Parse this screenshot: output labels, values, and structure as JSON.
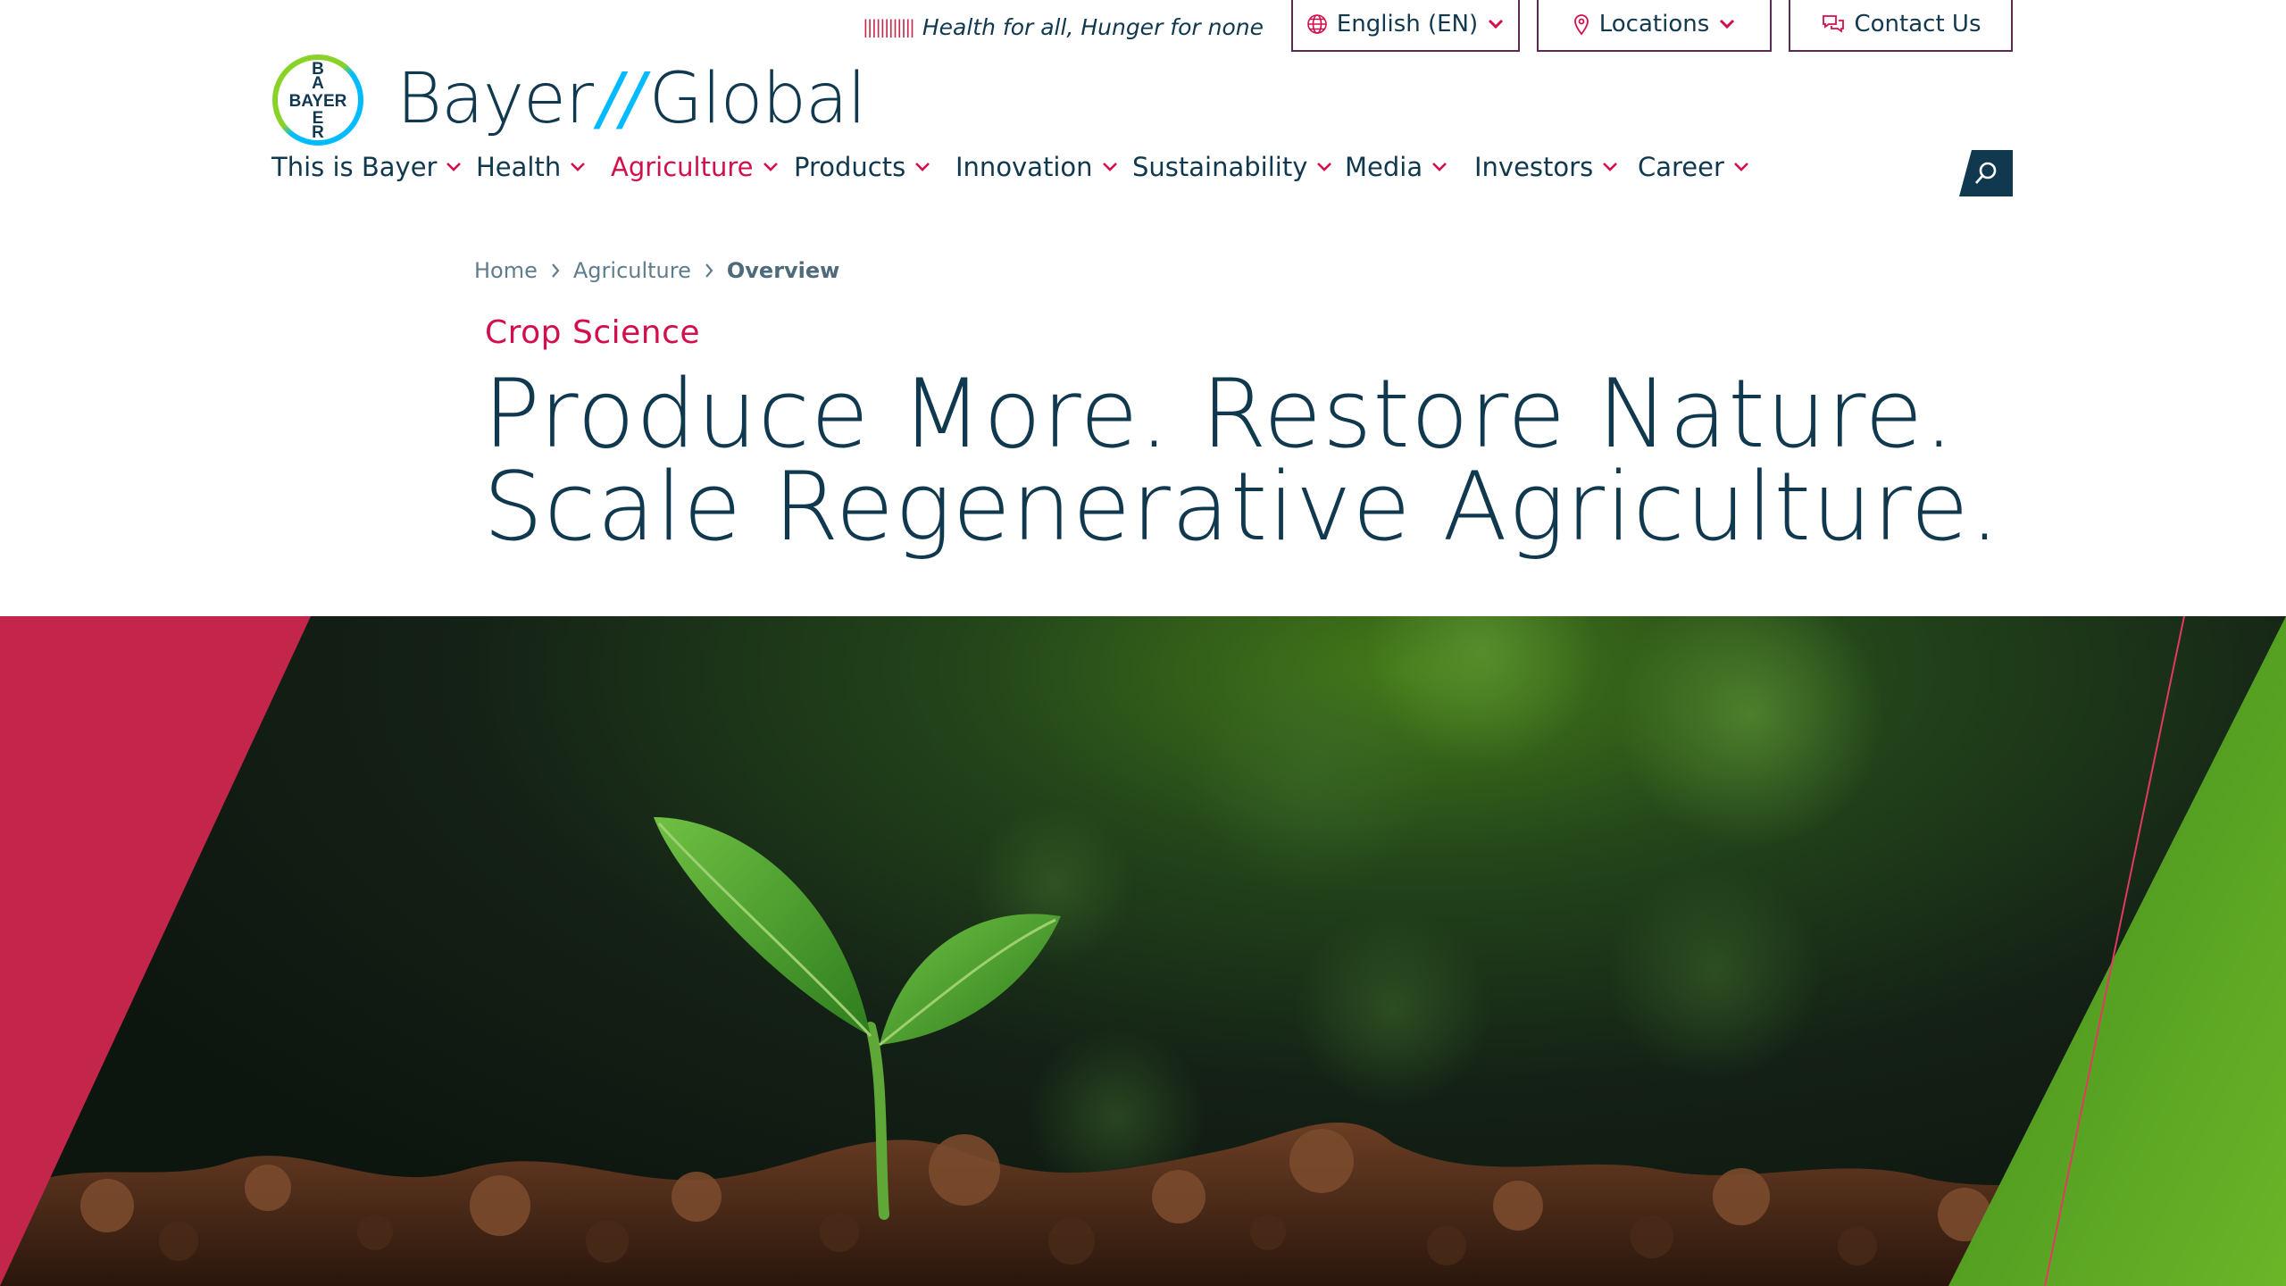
{
  "utility": {
    "tagline_mark": "||||||||||||",
    "tagline": "Health for all, Hunger for none",
    "language_label": "English (EN)",
    "locations_label": "Locations",
    "contact_label": "Contact Us"
  },
  "brand": {
    "logo_letters": "BAYER",
    "name": "Bayer",
    "separator": "//",
    "site": "Global"
  },
  "nav": {
    "items": [
      {
        "label": "This is Bayer"
      },
      {
        "label": "Health"
      },
      {
        "label": "Agriculture",
        "active": true
      },
      {
        "label": "Products"
      },
      {
        "label": "Innovation"
      },
      {
        "label": "Sustainability"
      },
      {
        "label": "Media"
      },
      {
        "label": "Investors"
      },
      {
        "label": "Career"
      }
    ]
  },
  "breadcrumb": [
    "Home",
    "Agriculture",
    "Overview"
  ],
  "hero": {
    "eyebrow": "Crop Science",
    "headline_line1": "Produce More. Restore Nature.",
    "headline_line2": "Scale Regenerative Agriculture."
  },
  "colors": {
    "navy": "#10384f",
    "accent_magenta": "#d30f4b",
    "brand_cyan": "#00bcff",
    "brand_green": "#89d329",
    "border_purple": "#5a2a54",
    "hero_magenta": "#c4254a",
    "hero_green": "#5ea623"
  },
  "icons": {
    "language": "globe-icon",
    "locations": "map-pin-icon",
    "contact": "chat-bubbles-icon",
    "search": "search-icon",
    "dropdown": "chevron-down-icon",
    "breadcrumb_separator": "chevron-right-icon"
  }
}
